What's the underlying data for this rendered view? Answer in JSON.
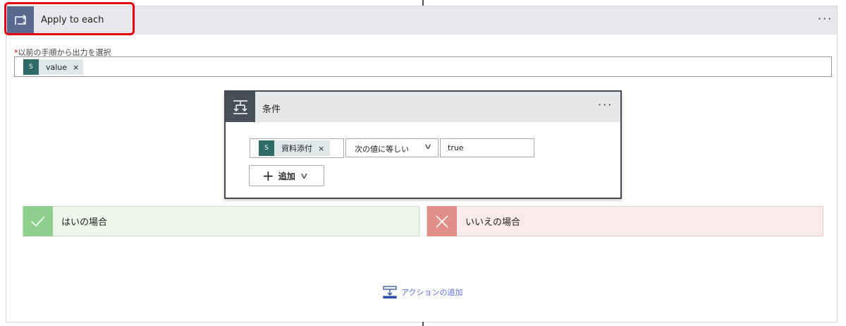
{
  "loop": {
    "title": "Apply to each",
    "more": "···",
    "field_label": "以前の手順から出力を選択",
    "required_mark": "*",
    "token": "value",
    "token_remove": "×",
    "token_icon": "S"
  },
  "condition": {
    "title": "条件",
    "more": "···",
    "left_token": "資料添付",
    "left_remove": "×",
    "operator": "次の値に等しい",
    "value": "true",
    "add_label": "追加",
    "add_plus": "+"
  },
  "branches": {
    "yes": "はいの場合",
    "no": "いいえの場合"
  },
  "add_action": "アクションの追加",
  "colors": {
    "loop_icon": "#5a6990",
    "yes": "#8fd08f",
    "no": "#e08e87",
    "highlight": "#e8000f",
    "link": "#5b6ee0"
  }
}
